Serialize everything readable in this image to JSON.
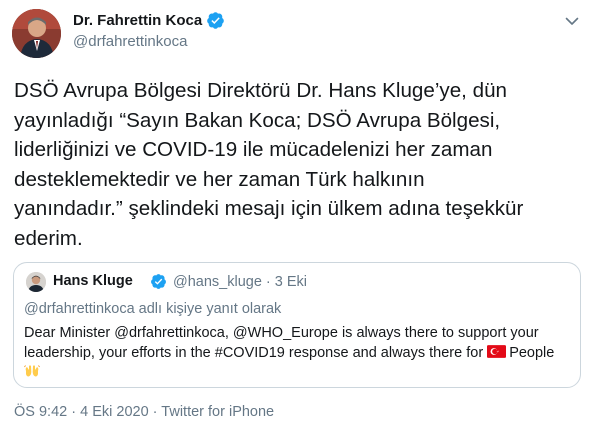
{
  "author": {
    "name": "Dr. Fahrettin Koca",
    "handle": "@drfahrettinkoca"
  },
  "tweet": {
    "lines": [
      "DSÖ Avrupa Bölgesi Direktörü Dr. Hans Kluge’ye, dün",
      "yayınladığı “Sayın Bakan Koca; DSÖ Avrupa Bölgesi,",
      "liderliğinizi ve COVID-19 ile mücadelenizi her zaman",
      "desteklemektedir ve her zaman Türk halkının",
      "yanındadır.” şeklindeki mesajı için ülkem adına teşekkür",
      "ederim."
    ]
  },
  "quoted_tweet": {
    "name": "Hans Kluge",
    "handle": "@hans_kluge",
    "separator": "·",
    "time": "3 Eki",
    "reply_to": "@drfahrettinkoca adlı kişiye yanıt olarak",
    "text_line1": "Dear Minister @drfahrettinkoca, @WHO_Europe is always there to support your",
    "text_line2_before": "leadership, your efforts in the #COVID19 response and always there for",
    "text_line2_after": "People",
    "icons": [
      "turkey-flag-icon",
      "raised-hands-icon"
    ]
  },
  "footer": {
    "time": "ÖS 9:42",
    "separator1": "·",
    "date": "4 Eki 2020",
    "separator2": "·",
    "source": "Twitter for iPhone"
  },
  "colors": {
    "text": "#14171a",
    "secondary": "#657786",
    "verified": "#1da1f2",
    "border": "#ccd6dd"
  }
}
